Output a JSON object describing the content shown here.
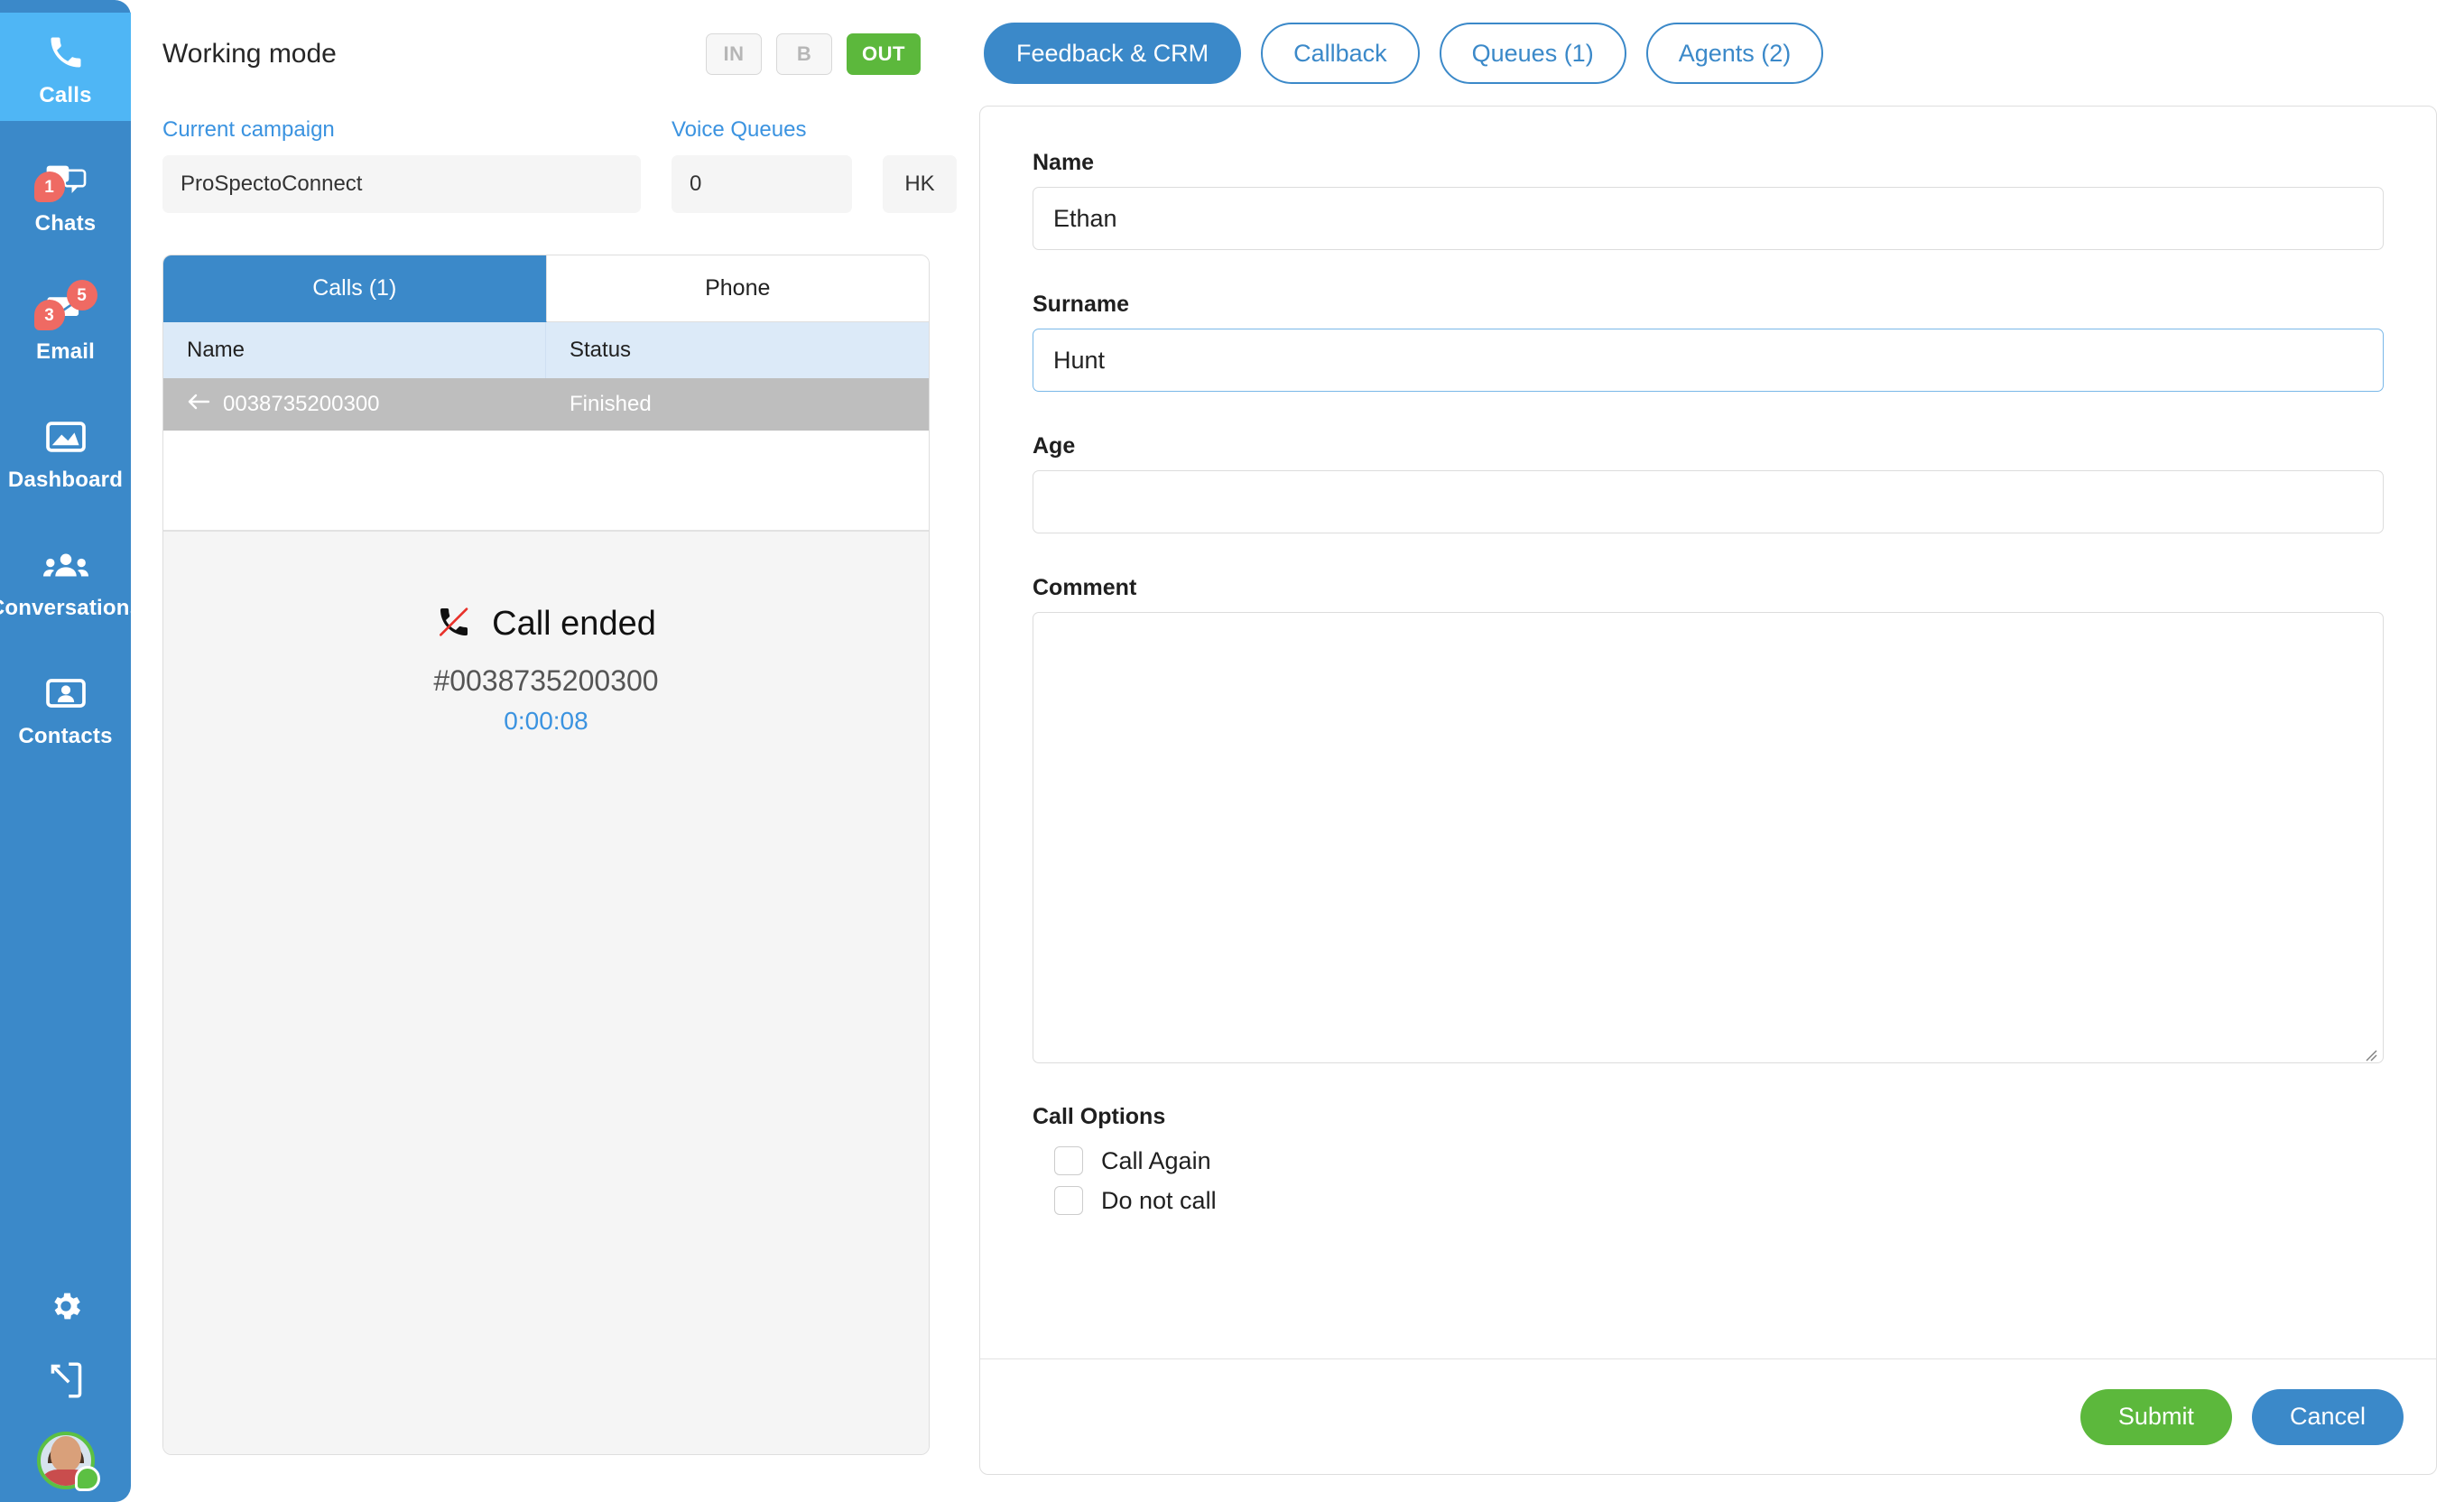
{
  "sidebar": {
    "items": [
      {
        "label": "Calls",
        "icon": "phone-icon",
        "active": true,
        "badges": []
      },
      {
        "label": "Chats",
        "icon": "chats-icon",
        "active": false,
        "badges": [
          {
            "value": "1",
            "position": "left"
          }
        ]
      },
      {
        "label": "Email",
        "icon": "email-icon",
        "active": false,
        "badges": [
          {
            "value": "5",
            "position": "right"
          },
          {
            "value": "3",
            "position": "left"
          }
        ]
      },
      {
        "label": "Dashboard",
        "icon": "dashboard-icon",
        "active": false,
        "badges": []
      },
      {
        "label": "Conversations",
        "icon": "conversations-icon",
        "active": false,
        "badges": []
      },
      {
        "label": "Contacts",
        "icon": "contacts-icon",
        "active": false,
        "badges": []
      }
    ],
    "bottom": [
      {
        "name": "settings-icon",
        "label": "Settings"
      },
      {
        "name": "logout-icon",
        "label": "Logout"
      }
    ],
    "avatar": {
      "name": "user-avatar",
      "status": "online"
    },
    "colors": {
      "background": "#3b89c9",
      "active": "#4fb6f5",
      "badge": "#ef6a63",
      "online": "#5cc043"
    }
  },
  "working_mode": {
    "title": "Working mode",
    "mode_buttons": [
      {
        "label": "IN",
        "active": false
      },
      {
        "label": "B",
        "active": false
      },
      {
        "label": "OUT",
        "active": true
      }
    ],
    "active_color": "#5cb83c"
  },
  "campaign": {
    "label": "Current campaign",
    "value": "ProSpectoConnect"
  },
  "voice_queues": {
    "label": "Voice Queues",
    "value": "0",
    "code": "HK"
  },
  "call_panel": {
    "tabs": [
      {
        "label": "Calls (1)",
        "active": true
      },
      {
        "label": "Phone",
        "active": false
      }
    ],
    "columns": [
      "Name",
      "Status"
    ],
    "rows": [
      {
        "direction_icon": "arrow-left-icon",
        "name": "0038735200300",
        "status": "Finished"
      }
    ],
    "call_status": {
      "icon": "phone-missed-icon",
      "title": "Call ended",
      "number": "#0038735200300",
      "duration": "0:00:08",
      "duration_color": "#3b93e0"
    }
  },
  "tabs": [
    {
      "label": "Feedback & CRM",
      "active": true
    },
    {
      "label": "Callback",
      "active": false
    },
    {
      "label": "Queues (1)",
      "active": false
    },
    {
      "label": "Agents (2)",
      "active": false
    }
  ],
  "form": {
    "fields": [
      {
        "label": "Name",
        "value": "Ethan",
        "placeholder": "",
        "focused": false
      },
      {
        "label": "Surname",
        "value": "Hunt",
        "placeholder": "",
        "focused": true
      },
      {
        "label": "Age",
        "value": "",
        "placeholder": "",
        "focused": false
      }
    ],
    "comment": {
      "label": "Comment",
      "value": "",
      "placeholder": ""
    },
    "call_options": {
      "title": "Call Options",
      "options": [
        {
          "label": "Call Again",
          "checked": false
        },
        {
          "label": "Do not call",
          "checked": false
        }
      ]
    },
    "actions": {
      "submit": "Submit",
      "cancel": "Cancel"
    }
  }
}
